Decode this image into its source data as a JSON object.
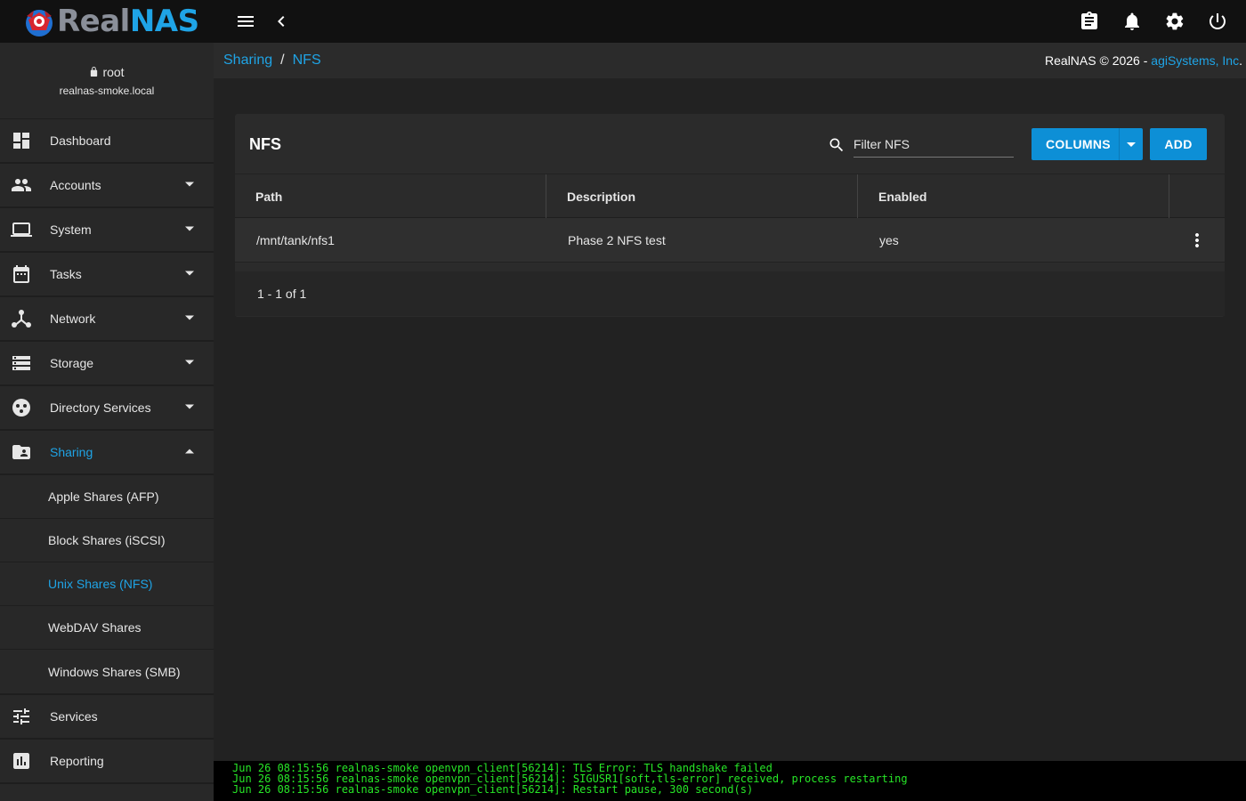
{
  "app": {
    "logo_part1": "Real",
    "logo_part2": "NAS",
    "brand_color": "#1fa4e6"
  },
  "topbar": {
    "icons": [
      "menu-icon",
      "chevron-left-icon",
      "clipboard-icon",
      "bell-icon",
      "gear-icon",
      "power-icon"
    ]
  },
  "user": {
    "name": "root",
    "host": "realnas-smoke.local"
  },
  "sidebar": {
    "items": [
      {
        "label": "Dashboard",
        "icon": "dashboard-icon"
      },
      {
        "label": "Accounts",
        "icon": "people-icon"
      },
      {
        "label": "System",
        "icon": "laptop-icon"
      },
      {
        "label": "Tasks",
        "icon": "calendar-icon"
      },
      {
        "label": "Network",
        "icon": "network-icon"
      },
      {
        "label": "Storage",
        "icon": "storage-icon"
      },
      {
        "label": "Directory Services",
        "icon": "directory-icon"
      },
      {
        "label": "Sharing",
        "icon": "folder-shared-icon"
      },
      {
        "label": "Services",
        "icon": "sliders-icon"
      },
      {
        "label": "Reporting",
        "icon": "chart-icon"
      }
    ],
    "sharing_sub": [
      {
        "label": "Apple Shares (AFP)"
      },
      {
        "label": "Block Shares (iSCSI)"
      },
      {
        "label": "Unix Shares (NFS)"
      },
      {
        "label": "WebDAV Shares"
      },
      {
        "label": "Windows Shares (SMB)"
      }
    ]
  },
  "breadcrumb": {
    "part1": "Sharing",
    "separator": "/",
    "part2": "NFS"
  },
  "copyright": {
    "text": "RealNAS © 2026 - ",
    "link": "agiSystems, Inc",
    "suffix": "."
  },
  "card": {
    "title": "NFS",
    "filter_placeholder": "Filter NFS",
    "columns_label": "COLUMNS",
    "add_label": "ADD",
    "headers": [
      "Path",
      "Description",
      "Enabled"
    ],
    "rows": [
      {
        "path": "/mnt/tank/nfs1",
        "description": "Phase 2 NFS test",
        "enabled": "yes"
      }
    ],
    "pagination": "1 - 1 of 1"
  },
  "console": {
    "lines": [
      "Jun 26 08:15:56 realnas-smoke openvpn_client[56214]: TLS Error: TLS handshake failed",
      "Jun 26 08:15:56 realnas-smoke openvpn_client[56214]: SIGUSR1[soft,tls-error] received, process restarting",
      "Jun 26 08:15:56 realnas-smoke openvpn_client[56214]: Restart pause, 300 second(s)"
    ],
    "text_color": "#27e627"
  }
}
